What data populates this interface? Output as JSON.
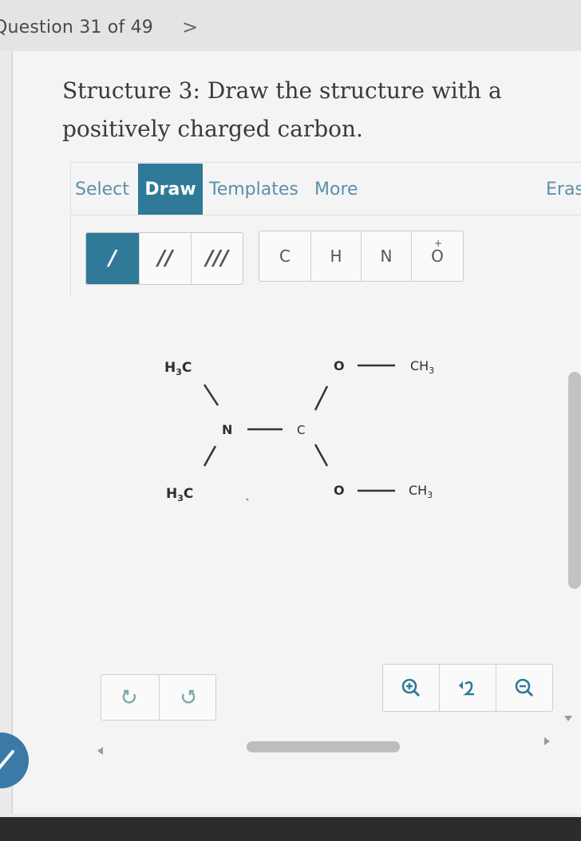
{
  "header": {
    "question_counter": "Question 31 of 49",
    "next_symbol": ">"
  },
  "prompt": {
    "text": "Structure 3: Draw the structure with a positively charged carbon."
  },
  "editor": {
    "tabs": {
      "select": "Select",
      "draw": "Draw",
      "templates": "Templates",
      "more": "More",
      "erase": "Eras"
    },
    "bond_tools": {
      "single": "/",
      "double": "//",
      "triple": "///",
      "selected": "single"
    },
    "atom_tools": {
      "carbon": "C",
      "hydrogen": "H",
      "nitrogen": "N",
      "oxygen": "O"
    },
    "accent_color": "#2f7a98"
  },
  "molecule": {
    "atoms": {
      "h3c_top": "H3C",
      "h3c_bottom": "H3C",
      "n": "N",
      "c": "C",
      "o_top": "O",
      "o_bottom": "O",
      "ch3_top": "CH3",
      "ch3_bottom": "CH3"
    }
  },
  "bottom_controls": {
    "undo_icon": "undo-icon",
    "redo_icon": "redo-icon",
    "zoom_in_icon": "zoom-in-icon",
    "reset_icon": "reset-zoom-icon",
    "zoom_out_icon": "zoom-out-icon"
  }
}
